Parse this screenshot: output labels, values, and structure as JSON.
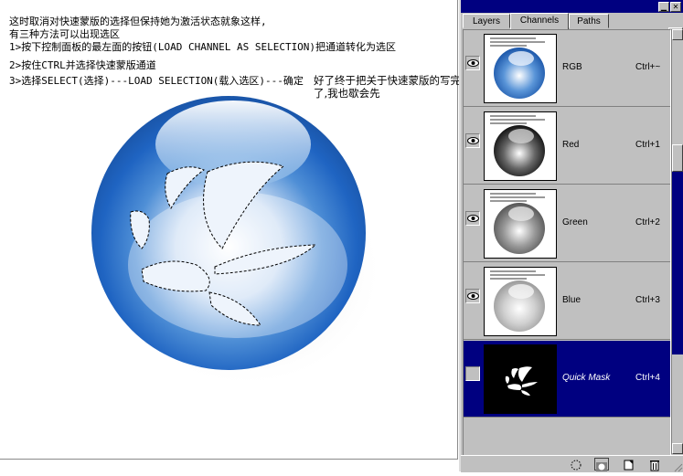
{
  "canvas": {
    "notes": [
      "这时取消对快速蒙版的选择但保持她为激活状态就象这样,",
      "有三种方法可以出现选区",
      "1>按下控制面板的最左面的按钮(LOAD CHANNEL AS SELECTION)把通道转化为选区",
      "2>按住CTRL并选择快速蒙版通道",
      "3>选择SELECT(选择)---LOAD SELECTION(载入选区)---确定"
    ],
    "side_note_1": "好了终于把关于快速蒙版的写完",
    "side_note_2": "了,我也歇会先"
  },
  "panel": {
    "tabs": [
      "Layers",
      "Channels",
      "Paths"
    ],
    "active_tab": "Channels",
    "channels": [
      {
        "name": "RGB",
        "shortcut": "Ctrl+~",
        "visible": true,
        "thumb": "rgb"
      },
      {
        "name": "Red",
        "shortcut": "Ctrl+1",
        "visible": true,
        "thumb": "red"
      },
      {
        "name": "Green",
        "shortcut": "Ctrl+2",
        "visible": true,
        "thumb": "green"
      },
      {
        "name": "Blue",
        "shortcut": "Ctrl+3",
        "visible": true,
        "thumb": "blue"
      },
      {
        "name": "Quick Mask",
        "shortcut": "Ctrl+4",
        "visible": false,
        "thumb": "mask",
        "selected": true
      }
    ],
    "colors": {
      "title_bar": "#000080",
      "selected_row": "#000080",
      "panel_bg": "#c0c0c0"
    },
    "bottom_buttons": [
      "load-channel-as-selection",
      "save-selection-as-channel",
      "new-channel",
      "delete-channel"
    ]
  }
}
